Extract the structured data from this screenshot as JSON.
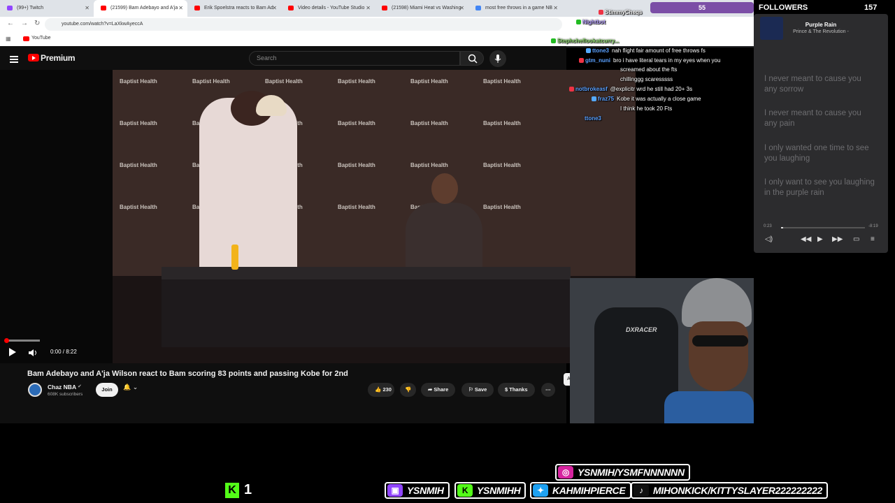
{
  "browser": {
    "tabs": [
      {
        "label": "(99+) Twitch",
        "color": "#9146ff"
      },
      {
        "label": "(21599) Bam Adebayo and A'ja",
        "color": "#ff0000"
      },
      {
        "label": "Erik Spoelstra reacts to Bam Ad",
        "color": "#ff0000"
      },
      {
        "label": "Video details - YouTube Studio",
        "color": "#ff0000"
      },
      {
        "label": "(21598) Miami Heat vs Washing",
        "color": "#ff0000"
      },
      {
        "label": "most free throws in a game NB",
        "color": "#4285f4"
      }
    ],
    "url": "youtube.com/watch?v=LaXkwAyeccA",
    "bookmark": "YouTube"
  },
  "youtube": {
    "logo": "Premium",
    "search_placeholder": "Search",
    "time": "0:00 / 8:22",
    "title": "Bam Adebayo and A'ja Wilson react to Bam scoring 83 points and passing Kobe for 2nd",
    "channel": "Chaz NBA",
    "subscribers": "608K subscribers",
    "join": "Join",
    "likes": "230",
    "share": "Share",
    "save": "Save",
    "thanks": "Thanks",
    "all_chip": "All",
    "backdrop_text": "Baptist Health",
    "progress_fraction": 0.0
  },
  "chat": {
    "sub_count": "55",
    "messages": [
      {
        "user": "StimmyCheqs",
        "text": "",
        "color": "#ffffff"
      },
      {
        "user": "Nightbot",
        "text": "",
        "color": "#b8a2ff"
      },
      {
        "user": "Stephcheflookatcurry...",
        "text": "",
        "color": "#8ad66b"
      },
      {
        "user": "ttone3",
        "text": "nah flight fair amount of free throws fs",
        "color": "#5aa0ff"
      },
      {
        "user": "gtm_nuni",
        "text": "bro i have literal tears in my eyes when you",
        "color": "#5aa0ff"
      },
      {
        "user": "",
        "text": "screamed about the fts",
        "color": "#ffffff"
      },
      {
        "user": "",
        "text": "chillinggg scaresssss",
        "color": "#ffffff"
      },
      {
        "user": "notbrokeasf",
        "text": "@explicitr wrd he still had 20+ 3s",
        "color": "#5aa0ff"
      },
      {
        "user": "fraz75",
        "text": "Kobe it was actually a close game",
        "color": "#5aa0ff"
      },
      {
        "user": "",
        "text": "I think he took 20 Fts",
        "color": "#ffffff"
      },
      {
        "user": "ttone3",
        "text": "",
        "color": "#5aa0ff"
      }
    ]
  },
  "music": {
    "followers_label": "FOLLOWERS",
    "followers_count": "157",
    "song": "Purple Rain",
    "artist": "Prince & The Revolution -",
    "lyrics": [
      "I never meant to cause you any sorrow",
      "I never meant to cause you any pain",
      "I only wanted one time to see you laughing",
      "I only want to see you laughing in the purple rain"
    ],
    "time_start": "0:23",
    "time_end": "-8:19"
  },
  "webcam": {
    "chair_logo": "DXRACER"
  },
  "bottom": {
    "kick_count": "1",
    "socials": [
      {
        "name": "instagram",
        "handle": "YSNMIH/YSMFNNNNNN"
      },
      {
        "name": "twitch",
        "handle": "YSNMIH"
      },
      {
        "name": "kick",
        "handle": "YSNMIHH"
      },
      {
        "name": "twitter",
        "handle": "KAHMIHPIERCE"
      },
      {
        "name": "tiktok",
        "handle": "MIHONKICK/KITTYSLAYER222222222"
      }
    ]
  }
}
